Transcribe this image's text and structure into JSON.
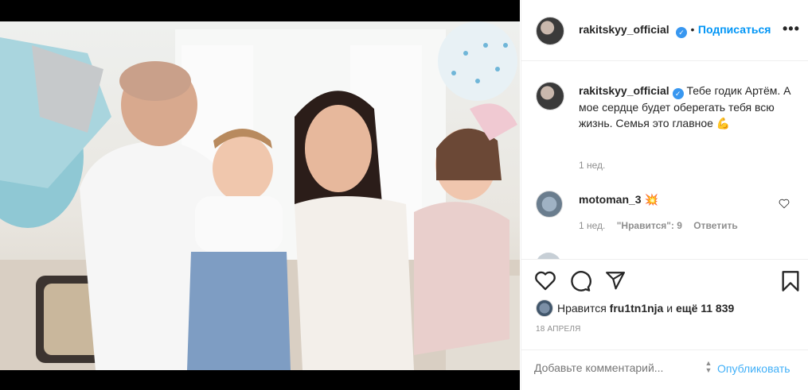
{
  "post": {
    "author": "rakitskyy_official",
    "follow_label": "Подписаться",
    "more_icon": "more-horizontal-icon",
    "verified_icon": "verified-badge-icon"
  },
  "caption": {
    "author": "rakitskyy_official",
    "text": "Тебе годик Артём. А мое сердце будет оберегать тебя всю жизнь. Семья это главное",
    "emoji": "💪",
    "time": "1 нед."
  },
  "comments": [
    {
      "user": "motoman_3",
      "emoji": "💥",
      "time": "1 нед.",
      "likes": "\"Нравится\": 9",
      "reply_label": "Ответить"
    }
  ],
  "actions": {
    "like_icon": "heart-icon",
    "comment_icon": "comment-icon",
    "share_icon": "share-icon",
    "save_icon": "bookmark-icon"
  },
  "likes": {
    "prefix": "Нравится",
    "user": "fru1tn1nja",
    "connector": "и",
    "rest": "ещё 11 839"
  },
  "date": "18 АПРЕЛЯ",
  "comment_box": {
    "placeholder": "Добавьте комментарий...",
    "publish_label": "Опубликовать"
  }
}
